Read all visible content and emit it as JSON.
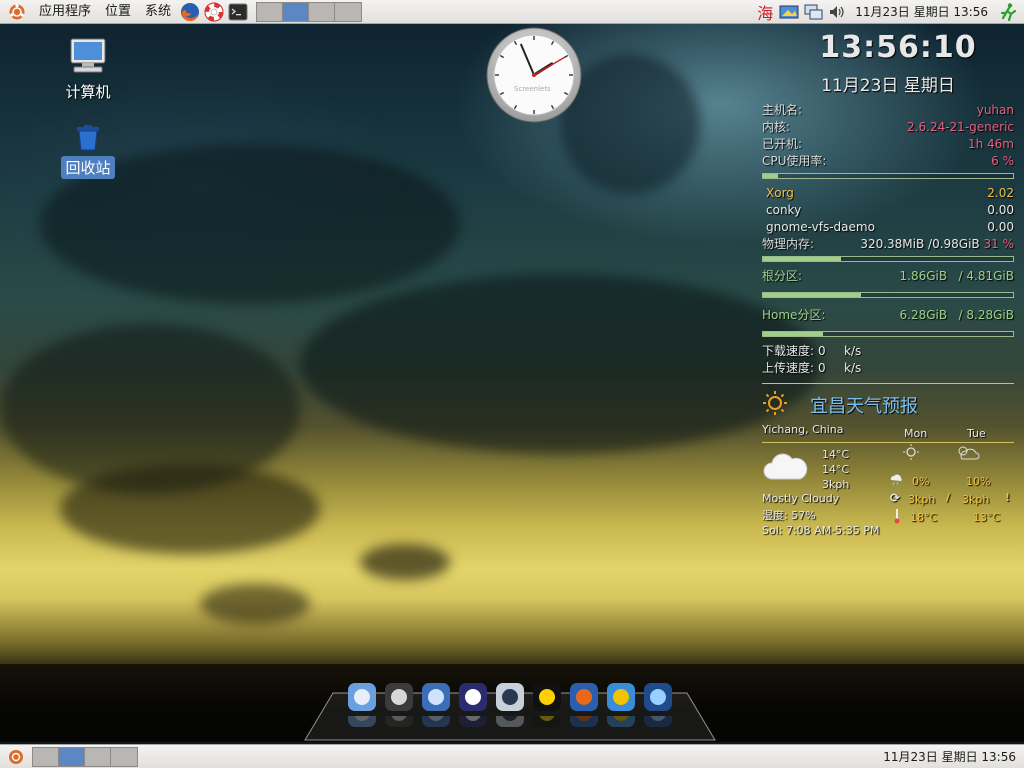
{
  "top_panel": {
    "menus": [
      "应用程序",
      "位置",
      "系统"
    ],
    "launchers": [
      "firefox-icon",
      "help-icon",
      "terminal-icon"
    ],
    "workspace_count": 4,
    "active_workspace": 2,
    "tray": {
      "input_method_label": "海",
      "clock": "11月23日 星期日  13:56"
    }
  },
  "bottom_panel": {
    "workspace_count": 4,
    "active_workspace": 2,
    "clock": "11月23日 星期日 13:56"
  },
  "desktop_icons": [
    {
      "label": "计算机",
      "icon": "computer-icon",
      "selected": false
    },
    {
      "label": "回收站",
      "icon": "trash-icon",
      "selected": true
    }
  ],
  "analog_clock": {
    "brand": "Screenlets",
    "hour": 13,
    "minute": 56,
    "second": 10
  },
  "conky": {
    "time": "13:56:10",
    "date": "11月23日 星期日",
    "hostname_label": "主机名:",
    "hostname": "yuhan",
    "kernel_label": "内核:",
    "kernel": "2.6.24-21-generic",
    "uptime_label": "已开机:",
    "uptime": "1h 46m",
    "cpu_label": "CPU使用率:",
    "cpu": "6  %",
    "cpu_fraction": 0.06,
    "processes": [
      {
        "name": "Xorg",
        "value": "2.02",
        "hot": true
      },
      {
        "name": "conky",
        "value": "0.00",
        "hot": false
      },
      {
        "name": "gnome-vfs-daemo",
        "value": "0.00",
        "hot": false
      }
    ],
    "mem_label": "物理内存:",
    "mem": "320.38MiB /0.98GiB",
    "mem_pct": "31 %",
    "mem_fraction": 0.31,
    "root_label": "根分区:",
    "root_used": "1.86GiB",
    "root_total": "/ 4.81GiB",
    "root_fraction": 0.39,
    "home_label": "Home分区:",
    "home_used": "6.28GiB",
    "home_total": "/ 8.28GiB",
    "home_fraction": 0.24,
    "down_label": "下载速度:",
    "down_value": "0",
    "down_unit": "k/s",
    "up_label": "上传速度:",
    "up_value": "0",
    "up_unit": "k/s"
  },
  "weather": {
    "title": "宜昌天气预报",
    "location": "Yichang, China",
    "day1": "Mon",
    "day2": "Tue",
    "temp_now": "14°C",
    "feels_like": "14°C",
    "wind_now": "3kph",
    "condition": "Mostly Cloudy",
    "humidity": "湿度: 57%",
    "day1_precip": "0%",
    "day2_precip": "10%",
    "day1_wind": "3kph",
    "day2_wind": "3kph",
    "day1_temp": "18°C",
    "day2_temp": "13°C",
    "sun": "Sol: 7:08 AM-5:35 PM"
  },
  "dock": {
    "items": [
      "finder-icon",
      "time-machine-icon",
      "system-monitor-icon",
      "screen-icon",
      "media-icon",
      "qq-icon",
      "firefox-icon",
      "package-icon",
      "video-icon"
    ]
  }
}
